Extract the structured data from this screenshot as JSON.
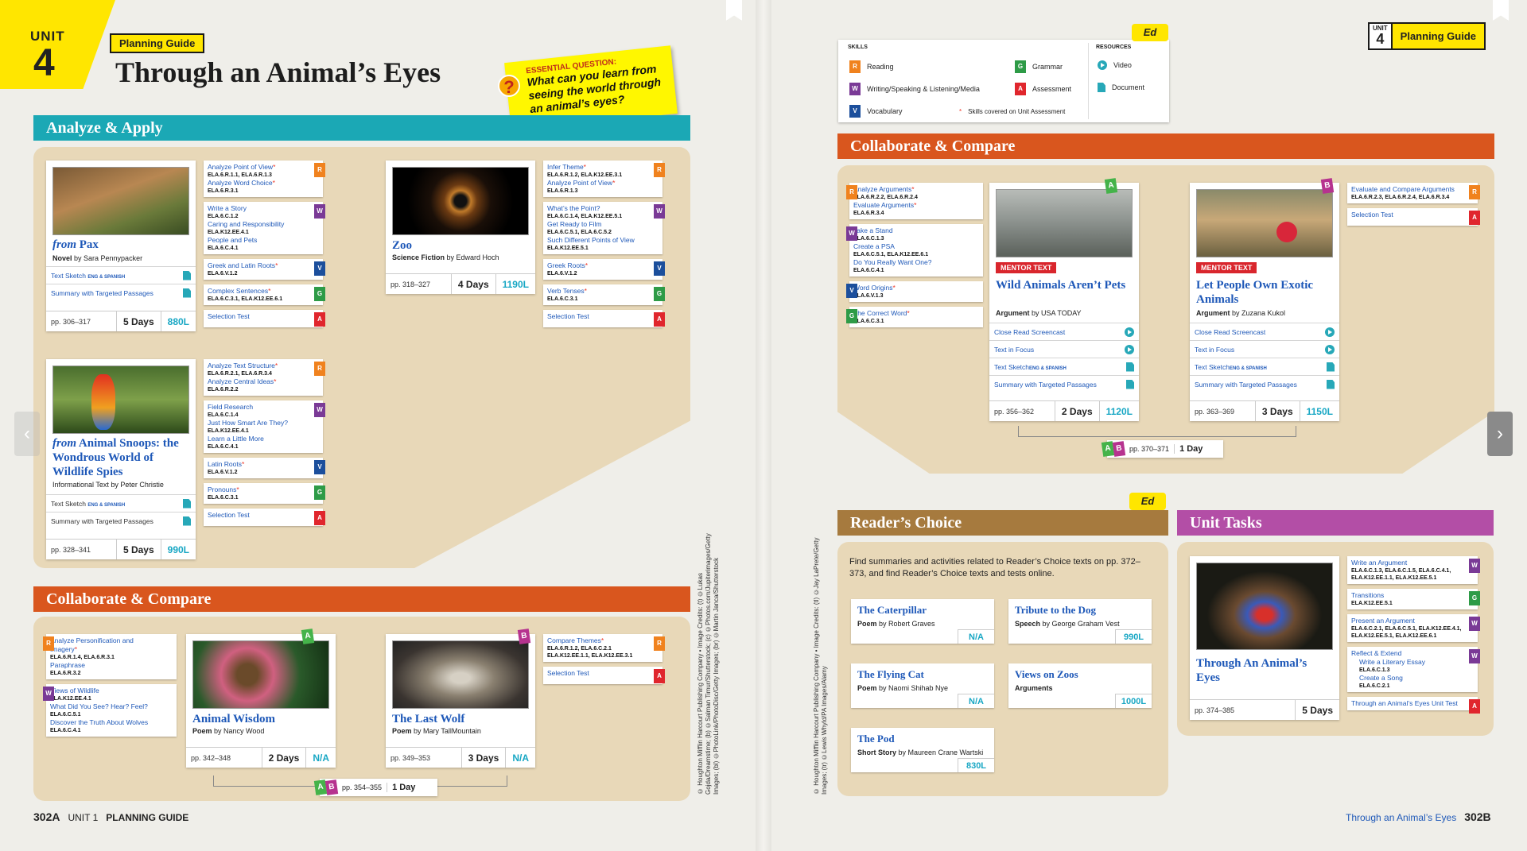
{
  "header": {
    "unit_label": "UNIT",
    "unit_number": "4",
    "planning_guide": "Planning Guide",
    "title": "Through an Animal’s Eyes"
  },
  "essential_question": {
    "label": "ESSENTIAL QUESTION:",
    "text": "What can you learn from seeing the world through an animal’s eyes?",
    "icon": "?"
  },
  "analyze_apply": {
    "heading": "Analyze & Apply",
    "pax": {
      "title_prefix": "from",
      "title": " Pax",
      "genre": "Novel",
      "by": " by Sara Pennypacker",
      "res1": "Text Sketch",
      "res1_tag": "ENG & SPANISH",
      "res2": "Summary with Targeted Passages",
      "pages": "pp. 306–317",
      "days": "5 Days",
      "lexile": "880L",
      "skills": [
        {
          "a": "Analyze Point of View",
          "b": "ELA.6.R.1.1, ELA.6.R.1.3",
          "c": "Analyze Word Choice",
          "d": "ELA.6.R.3.1",
          "tag": "R"
        },
        {
          "a": "Write a Story",
          "b": "ELA.6.C.1.2",
          "c": "Caring and Responsibility",
          "d": "ELA.K12.EE.4.1",
          "e": "People and Pets",
          "f": "ELA.6.C.4.1",
          "tag": "W"
        },
        {
          "a": "Greek and Latin Roots",
          "b": "ELA.6.V.1.2",
          "tag": "V"
        },
        {
          "a": "Complex Sentences",
          "b": "ELA.6.C.3.1, ELA.K12.EE.6.1",
          "tag": "G"
        },
        {
          "a": "Selection Test",
          "tag": "A"
        }
      ]
    },
    "zoo": {
      "title": "Zoo",
      "genre": "Science Fiction",
      "by": " by Edward Hoch",
      "pages": "pp. 318–327",
      "days": "4 Days",
      "lexile": "1190L",
      "skills": [
        {
          "a": "Infer Theme",
          "b": "ELA.6.R.1.2, ELA.K12.EE.3.1",
          "c": "Analyze Point of View",
          "d": "ELA.6.R.1.3",
          "tag": "R"
        },
        {
          "a": "What’s the Point?",
          "b": "ELA.6.C.1.4, ELA.K12.EE.5.1",
          "c": "Get Ready to Film",
          "d": "ELA.6.C.5.1, ELA.6.C.5.2",
          "e": "Such Different Points of View",
          "f": "ELA.K12.EE.5.1",
          "tag": "W"
        },
        {
          "a": "Greek Roots",
          "b": "ELA.6.V.1.2",
          "tag": "V"
        },
        {
          "a": "Verb Tenses",
          "b": "ELA.6.C.3.1",
          "tag": "G"
        },
        {
          "a": "Selection Test",
          "tag": "A"
        }
      ]
    },
    "snoops": {
      "title_prefix": "from",
      "title": " Animal Snoops: the Wondrous World of Wildlife Spies",
      "genre": "Informational Text",
      "by": " by Peter Christie",
      "res1": "Text Sketch",
      "res1_tag": "ENG & SPANISH",
      "res2": "Summary with Targeted Passages",
      "pages": "pp. 328–341",
      "days": "5 Days",
      "lexile": "990L",
      "skills": [
        {
          "a": "Analyze Text Structure",
          "b": "ELA.6.R.2.1, ELA.6.R.3.4",
          "c": "Analyze Central Ideas",
          "d": "ELA.6.R.2.2",
          "tag": "R"
        },
        {
          "a": "Field Research",
          "b": "ELA.6.C.1.4",
          "c": "Just How Smart Are They?",
          "d": "ELA.K12.EE.4.1",
          "e": "Learn a Little More",
          "f": "ELA.6.C.4.1",
          "tag": "W"
        },
        {
          "a": "Latin Roots",
          "b": "ELA.6.V.1.2",
          "tag": "V"
        },
        {
          "a": "Pronouns",
          "b": "ELA.6.C.3.1",
          "tag": "G"
        },
        {
          "a": "Selection Test",
          "tag": "A"
        }
      ]
    }
  },
  "collab_left": {
    "heading": "Collaborate & Compare",
    "skills_left": [
      {
        "a": "Analyze Personification and Imagery",
        "b": "ELA.6.R.1.4, ELA.6.R.3.1",
        "c": "Paraphrase",
        "d": "ELA.6.R.3.2",
        "tag": "R"
      },
      {
        "a": "Views of Wildlife",
        "b": "ELA.K12.EE.4.1",
        "c": "What Did You See? Hear? Feel?",
        "d": "ELA.6.C.5.1",
        "e": "Discover the Truth About Wolves",
        "f": "ELA.6.C.4.1",
        "tag": "W"
      }
    ],
    "wisdom": {
      "title": "Animal Wisdom",
      "genre": "Poem",
      "by": " by Nancy Wood",
      "pages": "pp. 342–348",
      "days": "2 Days",
      "lexile": "N/A",
      "ab": "A"
    },
    "wolf": {
      "title": "The Last Wolf",
      "genre": "Poem",
      "by": " by Mary TallMountain",
      "pages": "pp. 349–353",
      "days": "3 Days",
      "lexile": "N/A",
      "ab": "B"
    },
    "skills_right": [
      {
        "a": "Compare Themes",
        "b": "ELA.6.R.1.2, ELA.6.C.2.1",
        "c": "ELA.K12.EE.1.1, ELA.K12.EE.3.1",
        "tag": "R"
      },
      {
        "a": "Selection Test",
        "tag": "A"
      }
    ],
    "compare_pages": "pp. 354–355",
    "compare_days": "1 Day"
  },
  "footer_left": {
    "page": "302A",
    "unit": "UNIT 1",
    "label": "PLANNING GUIDE"
  },
  "credits_left": "© Houghton Mifflin Harcourt Publishing Company • Image Credits: (t) ©Lukas Gojda/Dreamstime; (b) ©Salman Timur/Shutterstock; (c) ©Photos.com/Jupiterimages/Getty Images; (bl) ©PhotoLink/PhotoDisc/Getty Images; (br) ©Martin Janca/Shutterstock",
  "credits_right": "© Houghton Mifflin Harcourt Publishing Company • Image Credits: (tl) ©Jay LaPrete/Getty Images; (tr) ©Lewis Whyld/PA Images/Alamy",
  "legend": {
    "skills_label": "SKILLS",
    "resources_label": "RESOURCES",
    "reading": "Reading",
    "writing": "Writing/Speaking & Listening/Media",
    "vocab": "Vocabulary",
    "grammar": "Grammar",
    "assessment": "Assessment",
    "video": "Video",
    "document": "Document",
    "note": "Skills covered on Unit Assessment",
    "ed": "Ed"
  },
  "collab_right": {
    "heading": "Collaborate & Compare",
    "skills_left": [
      {
        "a": "Analyze Arguments",
        "b": "ELA.6.R.2.2, ELA.6.R.2.4",
        "c": "Evaluate Arguments",
        "d": "ELA.6.R.3.4",
        "tag": "R"
      },
      {
        "a": "Take a Stand",
        "b": "ELA.6.C.1.3",
        "c": "Create a PSA",
        "d": "ELA.6.C.5.1, ELA.K12.EE.6.1",
        "e": "Do You Really Want One?",
        "f": "ELA.6.C.4.1",
        "tag": "W"
      },
      {
        "a": "Word Origins",
        "b": "ELA.6.V.1.3",
        "tag": "V"
      },
      {
        "a": "The Correct Word",
        "b": "ELA.6.C.3.1",
        "tag": "G"
      }
    ],
    "mentor_label": "MENTOR TEXT",
    "pets": {
      "title": "Wild Animals Aren’t Pets",
      "genre": "Argument",
      "by": " by USA TODAY",
      "r1": "Close Read Screencast",
      "r2": "Text in Focus",
      "r3": "Text Sketch",
      "r3_tag": "ENG & SPANISH",
      "r4": "Summary with Targeted Passages",
      "pages": "pp. 356–362",
      "days": "2 Days",
      "lexile": "1120L",
      "ab": "A"
    },
    "exotic": {
      "title": "Let People Own Exotic Animals",
      "genre": "Argument",
      "by": " by Zuzana Kukol",
      "r1": "Close Read Screencast",
      "r2": "Text in Focus",
      "r3": "Text Sketch",
      "r3_tag": "ENG & SPANISH",
      "r4": "Summary with Targeted Passages",
      "pages": "pp. 363–369",
      "days": "3 Days",
      "lexile": "1150L",
      "ab": "B"
    },
    "skills_right": [
      {
        "a": "Evaluate and Compare Arguments",
        "b": "ELA.6.R.2.3, ELA.6.R.2.4, ELA.6.R.3.4",
        "tag": "R"
      },
      {
        "a": "Selection Test",
        "tag": "A"
      }
    ],
    "compare_pages": "pp. 370–371",
    "compare_days": "1 Day"
  },
  "readers_choice": {
    "heading": "Reader’s Choice",
    "intro": "Find summaries and activities related to Reader’s Choice texts on pp. 372–373, and find Reader’s Choice texts and tests online.",
    "items": [
      {
        "title": "The Caterpillar",
        "genre": "Poem",
        "by": " by Robert Graves",
        "lexile": "N/A"
      },
      {
        "title": "Tribute to the Dog",
        "genre": "Speech",
        "by": " by George Graham Vest",
        "lexile": "990L"
      },
      {
        "title": "The Flying Cat",
        "genre": "Poem",
        "by": " by Naomi Shihab Nye",
        "lexile": "N/A"
      },
      {
        "title": "Views on Zoos",
        "genre": "Arguments",
        "by": "",
        "lexile": "1000L"
      },
      {
        "title": "The Pod",
        "genre": "Short Story",
        "by": " by Maureen Crane Wartski",
        "lexile": "830L"
      }
    ]
  },
  "unit_tasks": {
    "heading": "Unit Tasks",
    "title": "Through An Animal’s Eyes",
    "pages": "pp. 374–385",
    "days": "5 Days",
    "skills": [
      {
        "a": "Write an Argument",
        "b": "ELA.6.C.1.3, ELA.6.C.1.5, ELA.6.C.4.1, ELA.K12.EE.1.1, ELA.K12.EE.5.1",
        "tag": "W"
      },
      {
        "a": "Transitions",
        "b": "ELA.K12.EE.5.1",
        "tag": "G"
      },
      {
        "a": "Present an Argument",
        "b": "ELA.6.C.2.1, ELA.6.C.5.1, ELA.K12.EE.4.1, ELA.K12.EE.5.1, ELA.K12.EE.6.1",
        "tag": "W"
      },
      {
        "a": "Reflect & Extend",
        "b": "",
        "c": "Write a Literary Essay",
        "d": "ELA.6.C.1.3",
        "e": "Create a Song",
        "f": "ELA.6.C.2.1",
        "tag": "W"
      },
      {
        "a": "Through an Animal’s Eyes Unit Test",
        "tag": "A"
      }
    ]
  },
  "footer_right": {
    "label": "Through an Animal’s Eyes",
    "page": "302B"
  },
  "nav": {
    "prev": "‹",
    "next": "›"
  }
}
